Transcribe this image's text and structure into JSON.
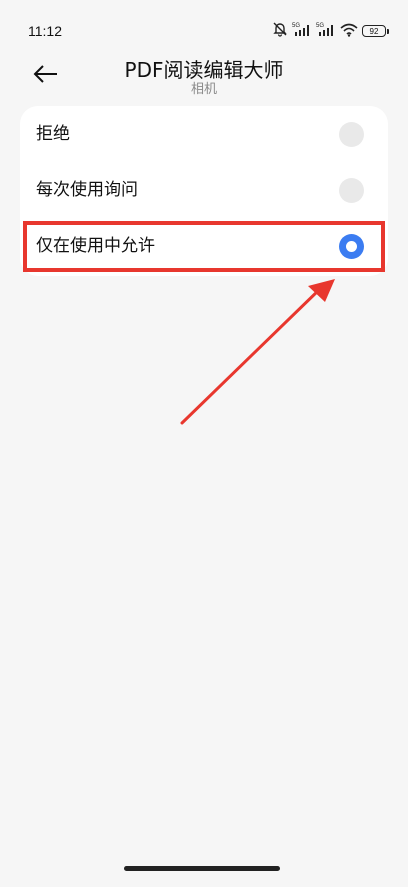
{
  "status_bar": {
    "time": "11:12",
    "battery": "92",
    "icons": [
      "mute-bell-icon",
      "signal-5g-icon",
      "signal-5g-icon",
      "wifi-icon",
      "battery-icon"
    ]
  },
  "header": {
    "title": "PDF阅读编辑大师",
    "subtitle": "相机",
    "back_icon": "back-arrow-icon"
  },
  "options": [
    {
      "label": "拒绝",
      "selected": false
    },
    {
      "label": "每次使用询问",
      "selected": false
    },
    {
      "label": "仅在使用中允许",
      "selected": true
    }
  ],
  "colors": {
    "accent": "#3b7cf1",
    "annotation": "#e8372e",
    "background": "#f6f6f6",
    "card": "#ffffff"
  }
}
